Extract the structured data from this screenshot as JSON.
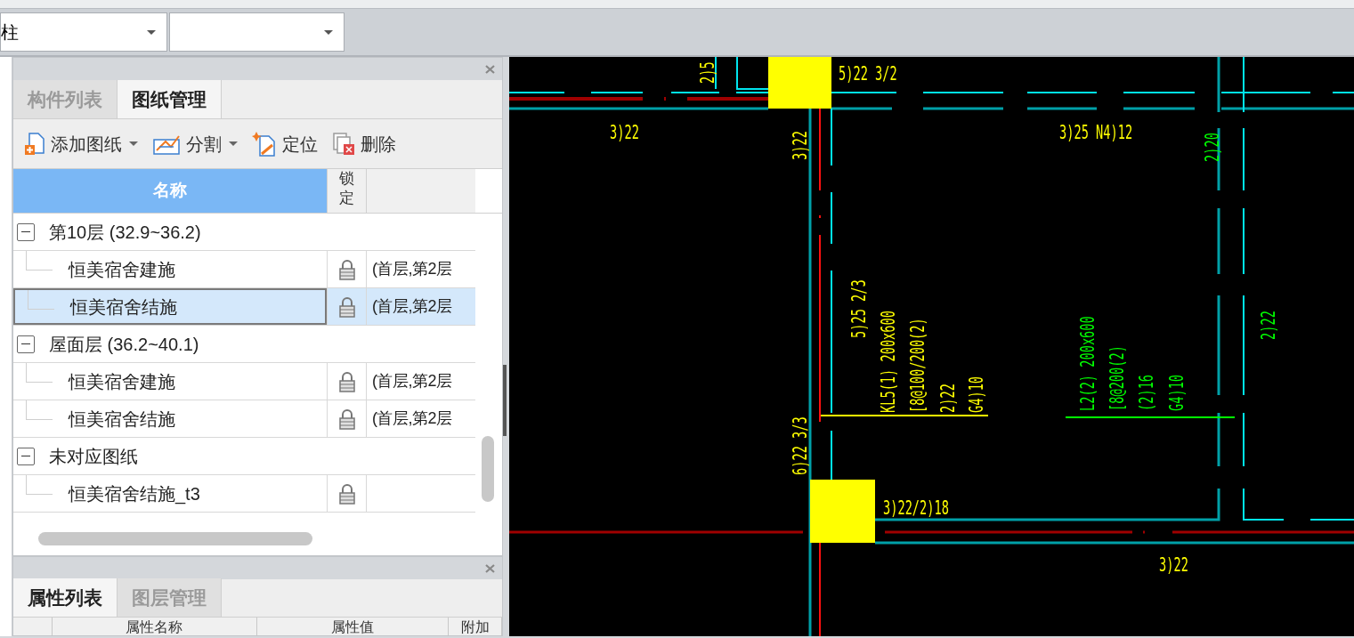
{
  "toolbar": {
    "component_dropdown": {
      "value": "柱"
    }
  },
  "drawing_panel": {
    "tabs": [
      {
        "label": "构件列表",
        "selected": false
      },
      {
        "label": "图纸管理",
        "selected": true
      }
    ],
    "actions": [
      {
        "kind": "add",
        "label": "添加图纸",
        "has_menu": true
      },
      {
        "kind": "split",
        "label": "分割",
        "has_menu": true
      },
      {
        "kind": "locate",
        "label": "定位",
        "has_menu": false
      },
      {
        "kind": "delete",
        "label": "删除",
        "has_menu": false
      }
    ],
    "columns": [
      "名称",
      "锁定"
    ],
    "tree": [
      {
        "label": "第10层 (32.9~36.2)",
        "expanded": true,
        "children": [
          {
            "label": "恒美宿舍建施",
            "locked": true,
            "floors": "(首层,第2层",
            "selected": false
          },
          {
            "label": "恒美宿舍结施",
            "locked": true,
            "floors": "(首层,第2层",
            "selected": true
          }
        ]
      },
      {
        "label": "屋面层 (36.2~40.1)",
        "expanded": true,
        "children": [
          {
            "label": "恒美宿舍建施",
            "locked": true,
            "floors": "(首层,第2层",
            "selected": false
          },
          {
            "label": "恒美宿舍结施",
            "locked": true,
            "floors": "(首层,第2层",
            "selected": false
          }
        ]
      },
      {
        "label": "未对应图纸",
        "expanded": true,
        "children": [
          {
            "label": "恒美宿舍结施_t3",
            "locked": true,
            "selected": false
          }
        ]
      }
    ]
  },
  "property_panel": {
    "tabs": [
      {
        "label": "属性列表",
        "selected": true
      },
      {
        "label": "图层管理",
        "selected": false
      }
    ],
    "columns": [
      "属性名称",
      "属性值",
      "附加"
    ]
  },
  "canvas": {
    "annotations": [
      {
        "text": "2)5",
        "color": "#ffff00"
      },
      {
        "text": "5)22 3/2",
        "color": "#ffff00"
      },
      {
        "text": "3)22",
        "color": "#ffff00"
      },
      {
        "text": "3)22",
        "color": "#ffff00"
      },
      {
        "text": "3)25 N4)12",
        "color": "#ffff00"
      },
      {
        "text": "2)20",
        "color": "#00ff00"
      },
      {
        "text": "5)25 2/3",
        "color": "#ffff00"
      },
      {
        "text": "KL5(1) 200x600",
        "color": "#ffff00"
      },
      {
        "text": "[8@100/200(2)",
        "color": "#ffff00"
      },
      {
        "text": "2)22",
        "color": "#ffff00"
      },
      {
        "text": "G4)10",
        "color": "#ffff00"
      },
      {
        "text": "L2(2) 200x600",
        "color": "#00ff00"
      },
      {
        "text": "[8@200(2)",
        "color": "#00ff00"
      },
      {
        "text": "(2)16",
        "color": "#00ff00"
      },
      {
        "text": "G4)10",
        "color": "#00ff00"
      },
      {
        "text": "2)22",
        "color": "#00ff00"
      },
      {
        "text": "6)22 3/3",
        "color": "#ffff00"
      },
      {
        "text": "3)22/2)18",
        "color": "#ffff00"
      },
      {
        "text": "3)22",
        "color": "#ffff00"
      }
    ]
  }
}
